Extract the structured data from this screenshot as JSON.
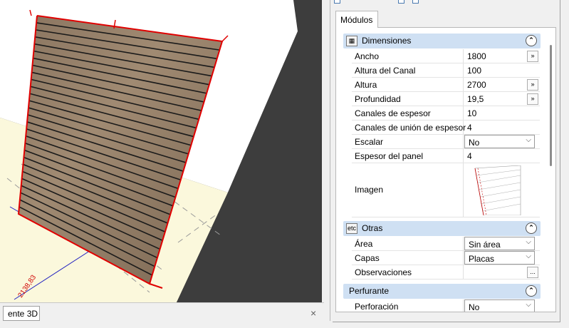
{
  "viewport": {
    "tab_label": "ente 3D",
    "dimension_label": "2138,83",
    "close_glyph": "×"
  },
  "panel": {
    "tab_label": "Módulos",
    "groups": {
      "dimensiones": {
        "icon": "table-icon",
        "title": "Dimensiones",
        "rows": [
          {
            "label": "Ancho",
            "value": "1800",
            "button": "»"
          },
          {
            "label": "Altura del Canal",
            "value": "100"
          },
          {
            "label": "Altura",
            "value": "2700",
            "button": "»"
          },
          {
            "label": "Profundidad",
            "value": "19,5",
            "button": "»"
          },
          {
            "label": "Canales de espesor",
            "value": "10"
          },
          {
            "label": "Canales de unión de espesor",
            "value": "4"
          },
          {
            "label": "Escalar",
            "value": "No"
          },
          {
            "label": "Espesor del panel",
            "value": "4"
          },
          {
            "label": "Imagen"
          }
        ]
      },
      "otras": {
        "icon_text": "etc",
        "title": "Otras",
        "rows": [
          {
            "label": "Área",
            "value": "Sin área"
          },
          {
            "label": "Capas",
            "value": "Placas"
          },
          {
            "label": "Observaciones",
            "button": "..."
          }
        ]
      },
      "perfurante": {
        "title": "Perfurante",
        "rows": [
          {
            "label": "Perforación",
            "value": "No"
          }
        ]
      }
    },
    "collapse_glyph": "⌃"
  }
}
